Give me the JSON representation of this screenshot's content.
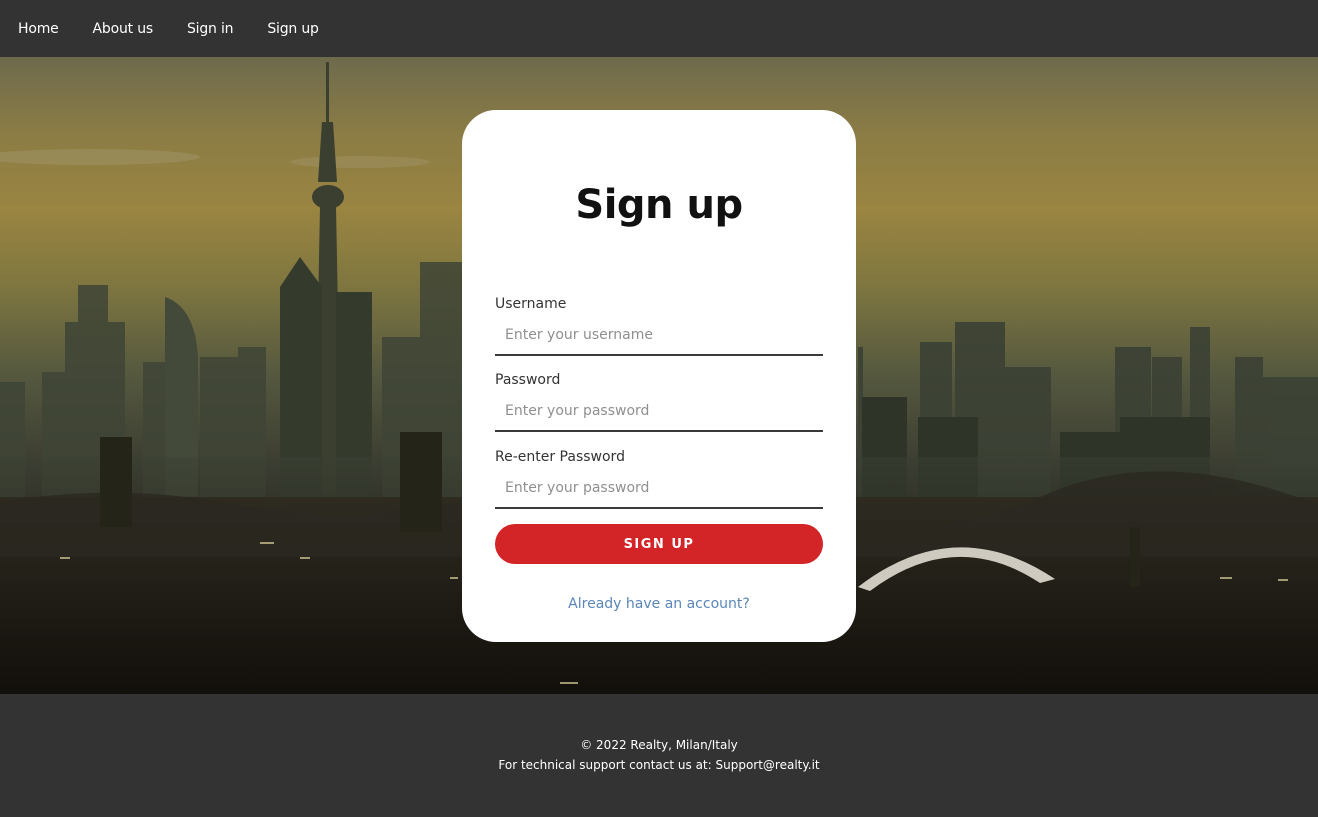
{
  "nav": {
    "items": [
      {
        "label": "Home"
      },
      {
        "label": "About us"
      },
      {
        "label": "Sign in"
      },
      {
        "label": "Sign up"
      }
    ]
  },
  "form": {
    "title": "Sign up",
    "username": {
      "label": "Username",
      "placeholder": "Enter your username",
      "value": ""
    },
    "password": {
      "label": "Password",
      "placeholder": "Enter your password",
      "value": ""
    },
    "repassword": {
      "label": "Re-enter Password",
      "placeholder": "Enter your password",
      "value": ""
    },
    "submit_label": "SIGN UP",
    "signin_link": "Already have an account?"
  },
  "footer": {
    "copyright": "© 2022 Realty, Milan/Italy",
    "support": "For technical support contact us at: Support@realty.it"
  },
  "colors": {
    "nav_bg": "#333333",
    "accent": "#d32427",
    "link": "#5a86b8"
  }
}
